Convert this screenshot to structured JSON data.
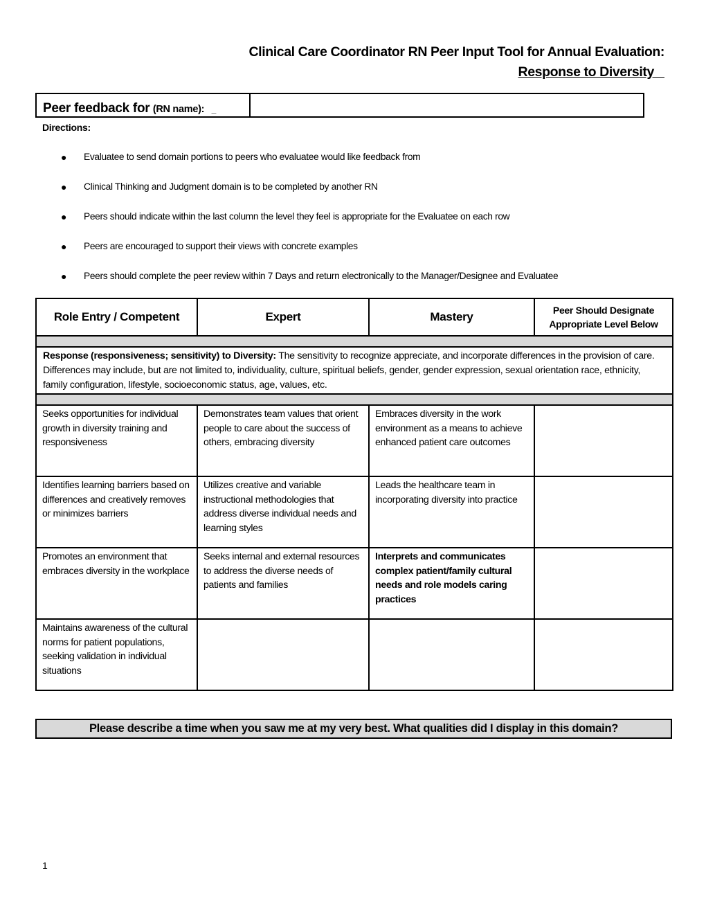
{
  "header": {
    "title": "Clinical Care Coordinator RN Peer Input Tool for Annual Evaluation:",
    "subtitle": "Response to Diversity   "
  },
  "peer_feedback": {
    "label_main": "Peer feedback for",
    "label_sub": "(RN name):",
    "label_blank": "_",
    "name_value": ""
  },
  "directions": {
    "heading": "Directions:",
    "items": [
      "Evaluatee to send domain portions to peers who evaluatee would like  feedback from",
      "Clinical Thinking and Judgment domain  is to be completed by another RN",
      "Peers should indicate within the last column the level they feel is appropriate for the Evaluatee on each row",
      "Peers are encouraged  to  support their views with concrete examples",
      "Peers should complete the peer review within 7 Days and return electronically to the Manager/Designee and Evaluatee"
    ]
  },
  "rubric": {
    "headers": [
      "Role Entry / Competent",
      "Expert",
      "Mastery",
      "Peer Should Designate Appropriate Level Below"
    ],
    "domain_title": "Response (responsiveness; sensitivity) to Diversity:",
    "domain_description": " The sensitivity to recognize appreciate, and incorporate differences in the provision of care.  Differences may include, but are not limited to, individuality, culture, spiritual beliefs, gender, gender expression, sexual orientation race, ethnicity, family configuration, lifestyle, socioeconomic status, age, values, etc.",
    "rows": [
      {
        "competent": "Seeks opportunities for individual growth in diversity training and responsiveness",
        "expert": "Demonstrates team values that orient people to care about the success of others, embracing diversity",
        "mastery": "Embraces diversity in the work environment as a means to achieve enhanced patient care outcomes",
        "peer_level": ""
      },
      {
        "competent": "Identifies learning barriers based on differences and creatively removes or minimizes barriers",
        "expert": "Utilizes creative and variable instructional methodologies that address diverse individual needs and learning styles",
        "mastery": "Leads the healthcare team in incorporating diversity into practice",
        "peer_level": ""
      },
      {
        "competent": "Promotes an environment that embraces diversity in the workplace",
        "expert": "Seeks internal and external resources to address the diverse needs of patients and families",
        "mastery": "Interprets and communicates complex patient/family cultural needs and role models caring practices",
        "peer_level": ""
      },
      {
        "competent": "Maintains awareness of the cultural norms for patient populations, seeking validation in individual situations",
        "expert": "",
        "mastery": "",
        "peer_level": ""
      }
    ]
  },
  "question": {
    "text": "Please describe a time when you saw me at my very best.  What qualities did I display in this domain?",
    "answer": ""
  },
  "footer": {
    "page_number": "1"
  }
}
